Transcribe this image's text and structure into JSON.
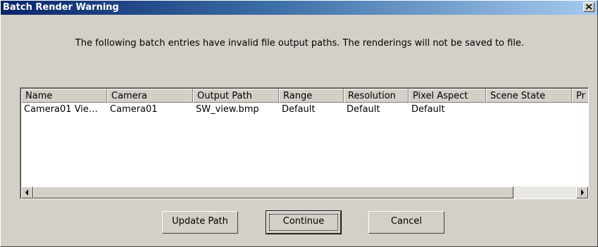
{
  "window": {
    "title": "Batch Render Warning",
    "close_label": "close"
  },
  "message": "The following batch entries have invalid file output paths. The renderings will not be saved to file.",
  "list": {
    "columns": [
      "Name",
      "Camera",
      "Output Path",
      "Range",
      "Resolution",
      "Pixel Aspect",
      "Scene State",
      "Pr"
    ],
    "rows": [
      [
        "Camera01 Vie…",
        "Camera01",
        "SW_view.bmp",
        "Default",
        "Default",
        "Default",
        "",
        ""
      ]
    ]
  },
  "buttons": {
    "update_path": "Update Path",
    "continue": "Continue",
    "cancel": "Cancel"
  }
}
